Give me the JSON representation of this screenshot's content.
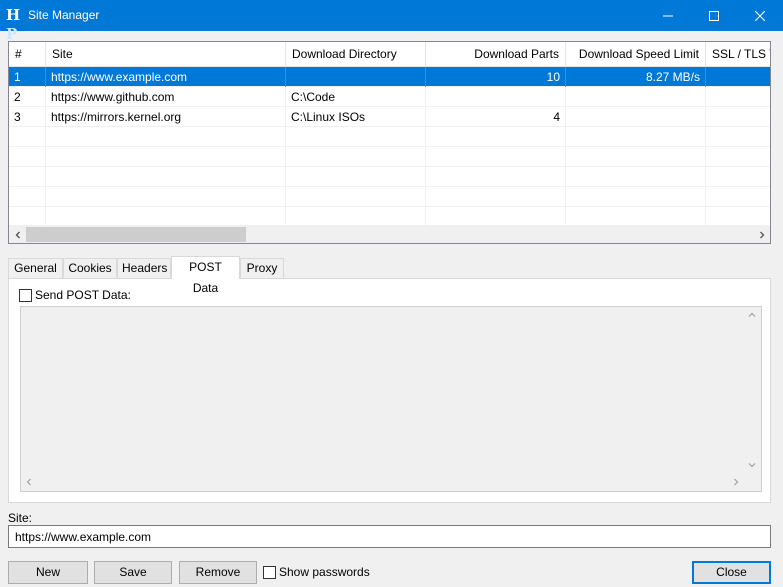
{
  "window": {
    "title": "Site Manager",
    "icon": "hp-logo-icon"
  },
  "grid": {
    "columns": [
      "#",
      "Site",
      "Download Directory",
      "Download Parts",
      "Download Speed Limit",
      "SSL / TLS Ve"
    ],
    "rows": [
      {
        "num": "1",
        "site": "https://www.example.com",
        "dir": "",
        "parts": "10",
        "speed": "8.27 MB/s",
        "ssl": ""
      },
      {
        "num": "2",
        "site": "https://www.github.com",
        "dir": "C:\\Code",
        "parts": "",
        "speed": "",
        "ssl": ""
      },
      {
        "num": "3",
        "site": "https://mirrors.kernel.org",
        "dir": "C:\\Linux ISOs",
        "parts": "4",
        "speed": "",
        "ssl": ""
      }
    ],
    "selected_row": 0
  },
  "tabs": [
    {
      "label": "General"
    },
    {
      "label": "Cookies"
    },
    {
      "label": "Headers"
    },
    {
      "label": "POST Data"
    },
    {
      "label": "Proxy"
    }
  ],
  "active_tab": "POST Data",
  "post_panel": {
    "send_post_label": "Send POST Data:",
    "checked": false
  },
  "site_field": {
    "label": "Site:",
    "value": "https://www.example.com"
  },
  "buttons": {
    "new": "New",
    "save": "Save",
    "remove": "Remove",
    "show_passwords": "Show passwords",
    "close": "Close"
  },
  "colors": {
    "accent": "#0078d7",
    "selection": "#0078d7"
  }
}
